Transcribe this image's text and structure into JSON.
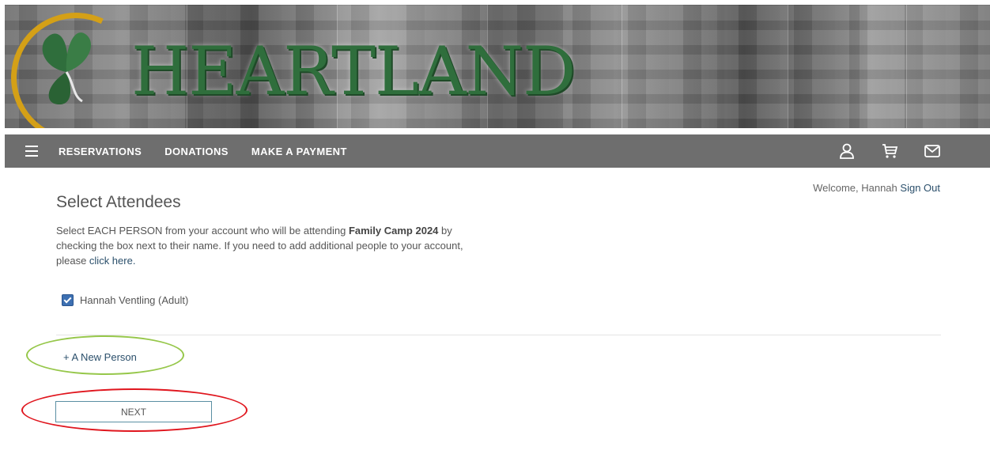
{
  "header": {
    "logo_text": "HEARTLAND",
    "brand_colors": {
      "green": "#2f6e3c",
      "gold": "#d4a017"
    }
  },
  "nav": {
    "menu_icon": "hamburger-icon",
    "links": [
      {
        "label": "RESERVATIONS"
      },
      {
        "label": "DONATIONS"
      },
      {
        "label": "MAKE A PAYMENT"
      }
    ],
    "icons": [
      "user-icon",
      "cart-icon",
      "mail-icon"
    ],
    "background": "#6e6e6e"
  },
  "welcome": {
    "text": "Welcome, Hannah",
    "sign_out": "Sign Out"
  },
  "page": {
    "title": "Select Attendees",
    "instructions_pre": "Select EACH PERSON from your account who will be attending ",
    "event_name": "Family Camp 2024",
    "instructions_post": " by checking the box next to their name. If you need to add additional people to your account, please ",
    "click_here": "click here."
  },
  "attendees": [
    {
      "name": "Hannah Ventling (Adult)",
      "checked": true
    }
  ],
  "add_person_label": "+ A New Person",
  "next_label": "NEXT",
  "annotations": {
    "green_ellipse": "#96c74a",
    "red_ellipse": "#e0161e"
  }
}
